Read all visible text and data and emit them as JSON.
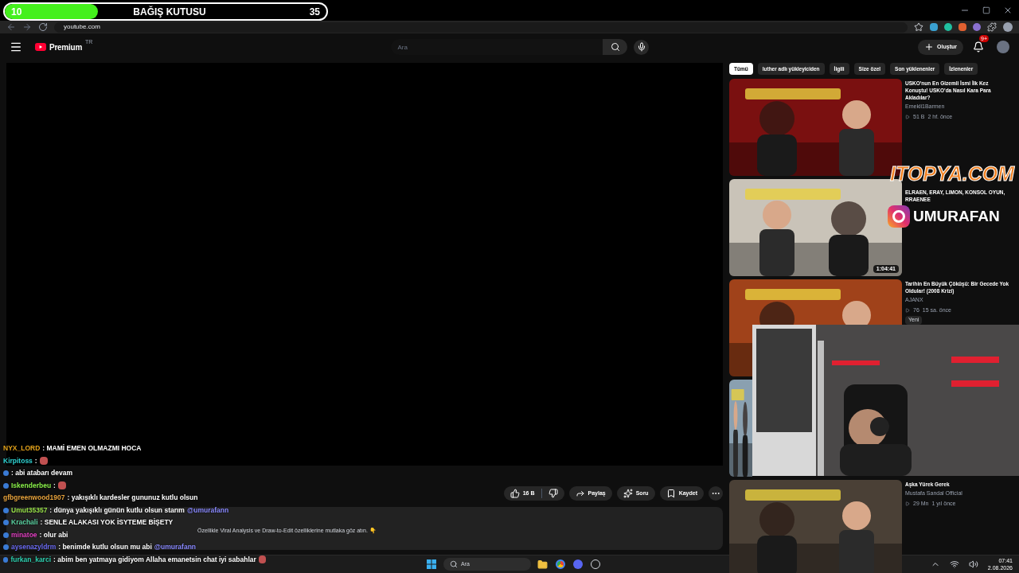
{
  "donation": {
    "current": "10",
    "title": "BAĞIŞ KUTUSU",
    "goal": "35",
    "level": 0.29
  },
  "browser": {
    "url": "youtube.com"
  },
  "header": {
    "logo": "Premium",
    "region": "TR",
    "search_placeholder": "Ara",
    "create": "Oluştur",
    "notifications": "9+"
  },
  "chips": [
    {
      "label": "Tümü",
      "selected": true
    },
    {
      "label": "luther adlı yükleyiciden",
      "selected": false
    },
    {
      "label": "İlgili",
      "selected": false
    },
    {
      "label": "Size özel",
      "selected": false
    },
    {
      "label": "Son yüklenenler",
      "selected": false
    },
    {
      "label": "İzlenenler",
      "selected": false
    }
  ],
  "videos": [
    {
      "kind": "video",
      "title": "USKO'nun En Gizemli İsmi İlk Kez Konuştu! USKO'da Nasıl Kara Para Akladılar?",
      "channel": "Emekli1Barmen",
      "views": "51 B",
      "age": "2 hf. önce"
    },
    {
      "kind": "video",
      "title": "ELRAEN, ERAY, LIMON, KONSOL OYUN, RRAENEE",
      "duration": "1:04:41"
    },
    {
      "kind": "video",
      "title": "Tarihin En Büyük Çöküşü: Bir Gecede Yok Oldular! (2008 Krizi)",
      "channel": "AJANX",
      "views": "76",
      "age": "15 sa. önce",
      "badge": "Yeni"
    },
    {
      "kind": "picture"
    },
    {
      "kind": "video",
      "title": "Aşka Yürek Gerek",
      "channel": "Mustafa Sandal Official",
      "views": "29 Mn",
      "age": "1 yıl önce"
    }
  ],
  "actions": {
    "likes": "16 B",
    "share": "Paylaş",
    "ask": "Soru",
    "save": "Kaydet"
  },
  "description": "Özellikle Viral Analysis ve Draw-to-Edit özelliklerine mutlaka göz atın. 👇",
  "overlay": {
    "sponsor": "ITOPYA.COM",
    "instagram": "UMURAFAN"
  },
  "chat": [
    {
      "user": "NYX_LORD",
      "color": "#e3a21a",
      "text": ": MAMİ EMEN OLMAZMI HOCA",
      "badge": false,
      "emote": false
    },
    {
      "user": "Kirpitoss",
      "color": "#2fd5d5",
      "text": ":",
      "badge": false,
      "emote": true
    },
    {
      "text": ": abi atabarı devam",
      "badge": true,
      "emote": false
    },
    {
      "user": "Iskenderbeu",
      "color": "#8af04a",
      "text": ":",
      "badge": true,
      "emote": true
    },
    {
      "user": "gfbgreenwood1907",
      "color": "#e6a23c",
      "text": ": yakışıklı kardesler gununuz kutlu olsun",
      "badge": false,
      "emote": false
    },
    {
      "user": "Umut35357",
      "color": "#9ae34a",
      "text": ": dünya yakışıklı günün kutlu olsun starım",
      "mention": "@umurafann",
      "badge": true,
      "emote": false
    },
    {
      "user": "Krachali",
      "color": "#5ad0a0",
      "text": ": SENLE ALAKASI YOK İSYTEME BİŞETY",
      "badge": true,
      "emote": false
    },
    {
      "user": "minatoe",
      "color": "#e040c0",
      "text": ": olur abi",
      "badge": true,
      "emote": false
    },
    {
      "user": "aysenazyldrm",
      "color": "#6a6af0",
      "text": ": benimde kutlu olsun mu abi",
      "mention": "@umurafann",
      "badge": true,
      "emote": false
    },
    {
      "user": "furkan_karci",
      "color": "#2ed0b0",
      "text": ": abim ben yatmaya gidiyom Allaha emanetsin chat iyi sabahlar",
      "badge": true,
      "emote": true
    }
  ],
  "taskbar": {
    "search": "Ara",
    "time": "07:41",
    "date": "2.08.2026"
  }
}
